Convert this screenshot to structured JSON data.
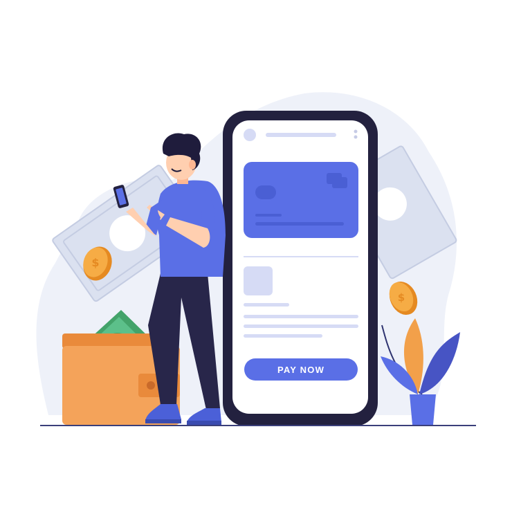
{
  "scene": "mobile-payment-illustration",
  "colors": {
    "accent": "#5a6fe6",
    "phone_frame": "#23213f",
    "shirt": "#5a6fe6",
    "pants": "#28264a",
    "wallet": "#f0a050",
    "coin": "#f5a23a",
    "cash": "#d9dff0",
    "background_blob": "#eef1f9",
    "ground_line": "#3a3f7a"
  },
  "phone": {
    "pay_button_label": "PAY NOW"
  },
  "icons": [
    "coin-icon",
    "banknote-icon",
    "wallet-icon",
    "plant-icon",
    "smartphone-icon",
    "credit-card-icon"
  ]
}
